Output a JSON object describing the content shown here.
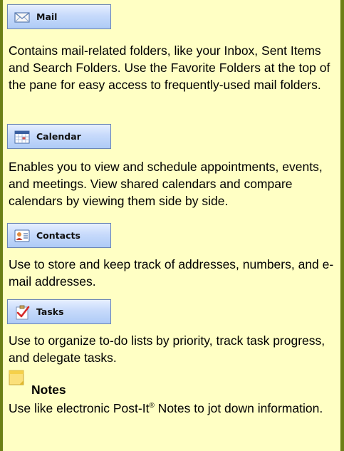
{
  "nav": [
    {
      "label": "Mail",
      "icon": "mail-envelope-icon",
      "description": "Contains mail-related folders, like your Inbox, Sent Items and Search Folders. Use the Favorite Folders at the top of the pane for easy access to frequently-used mail folders."
    },
    {
      "label": "Calendar",
      "icon": "calendar-icon",
      "description": "Enables you to view and schedule appointments, events, and meetings. View shared calendars and compare calendars by viewing them side by side."
    },
    {
      "label": "Contacts",
      "icon": "contact-card-icon",
      "description": "Use to store and keep track of addresses, numbers, and e-mail addresses."
    },
    {
      "label": "Tasks",
      "icon": "task-checkmark-icon",
      "description": "Use to organize to-do lists by priority, track task progress, and delegate tasks."
    }
  ],
  "notes": {
    "title": "Notes",
    "icon": "sticky-note-icon",
    "description_before": "Use like electronic Post-It",
    "registered_mark": "®",
    "description_after": " Notes to jot down information."
  },
  "colors": {
    "border": "#6b7f16",
    "background": "#ffffc4",
    "button_gradient_top": "#e6efff",
    "button_gradient_bottom": "#aecbf6"
  }
}
